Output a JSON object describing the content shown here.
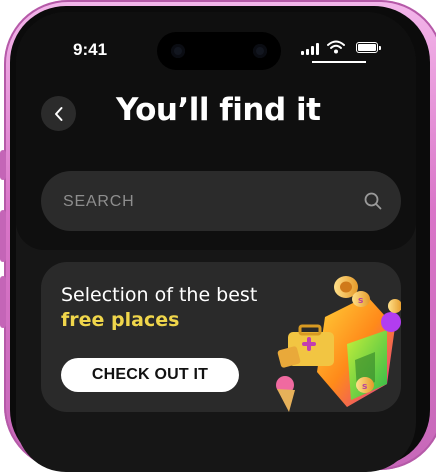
{
  "status_bar": {
    "time": "9:41"
  },
  "header": {
    "title": "You’ll find it",
    "back_icon": "chevron-left-icon"
  },
  "search": {
    "placeholder": "SEARCH",
    "icon": "search-icon"
  },
  "promo": {
    "title": "Selection of the best",
    "accent": "free places",
    "cta_label": "CHECK OUT IT",
    "accent_color": "#f0d64b"
  },
  "colors": {
    "background": "#161616",
    "surface": "#2b2b2b",
    "frame": "#d975c8"
  }
}
